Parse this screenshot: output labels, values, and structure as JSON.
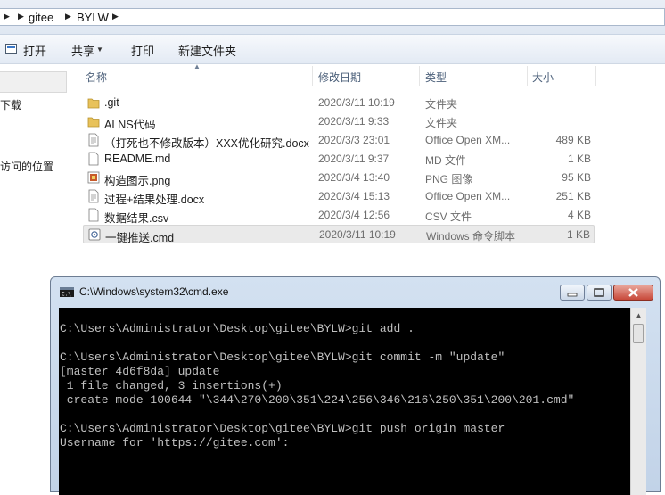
{
  "address": {
    "crumbs": [
      "gitee",
      "BYLW"
    ]
  },
  "toolbar": {
    "open": "打开",
    "share": "共享",
    "print": "打印",
    "new_folder": "新建文件夹"
  },
  "nav": {
    "items": [
      "下载",
      "访问的位置"
    ]
  },
  "columns": {
    "name": "名称",
    "date": "修改日期",
    "type": "类型",
    "size": "大小"
  },
  "files": [
    {
      "name": ".git",
      "date": "2020/3/11 10:19",
      "type": "文件夹",
      "size": "",
      "icon": "folder-icon"
    },
    {
      "name": "ALNS代码",
      "date": "2020/3/11 9:33",
      "type": "文件夹",
      "size": "",
      "icon": "folder-icon"
    },
    {
      "name": "（打死也不修改版本）XXX优化研究.docx",
      "date": "2020/3/3 23:01",
      "type": "Office Open XM...",
      "size": "489 KB",
      "icon": "document-icon"
    },
    {
      "name": "README.md",
      "date": "2020/3/11 9:37",
      "type": "MD 文件",
      "size": "1 KB",
      "icon": "file-icon"
    },
    {
      "name": "构造图示.png",
      "date": "2020/3/4 13:40",
      "type": "PNG 图像",
      "size": "95 KB",
      "icon": "image-icon"
    },
    {
      "name": "过程+结果处理.docx",
      "date": "2020/3/4 15:13",
      "type": "Office Open XM...",
      "size": "251 KB",
      "icon": "document-icon"
    },
    {
      "name": "数据结果.csv",
      "date": "2020/3/4 12:56",
      "type": "CSV 文件",
      "size": "4 KB",
      "icon": "file-icon"
    },
    {
      "name": "一键推送.cmd",
      "date": "2020/3/11 10:19",
      "type": "Windows 命令脚本",
      "size": "1 KB",
      "icon": "script-icon"
    }
  ],
  "cmd": {
    "title": "C:\\Windows\\system32\\cmd.exe",
    "lines": [
      "",
      "C:\\Users\\Administrator\\Desktop\\gitee\\BYLW>git add .",
      "",
      "C:\\Users\\Administrator\\Desktop\\gitee\\BYLW>git commit -m \"update\"",
      "[master 4d6f8da] update",
      " 1 file changed, 3 insertions(+)",
      " create mode 100644 \"\\344\\270\\200\\351\\224\\256\\346\\216\\250\\351\\200\\201.cmd\"",
      "",
      "C:\\Users\\Administrator\\Desktop\\gitee\\BYLW>git push origin master",
      "Username for 'https://gitee.com':"
    ]
  }
}
